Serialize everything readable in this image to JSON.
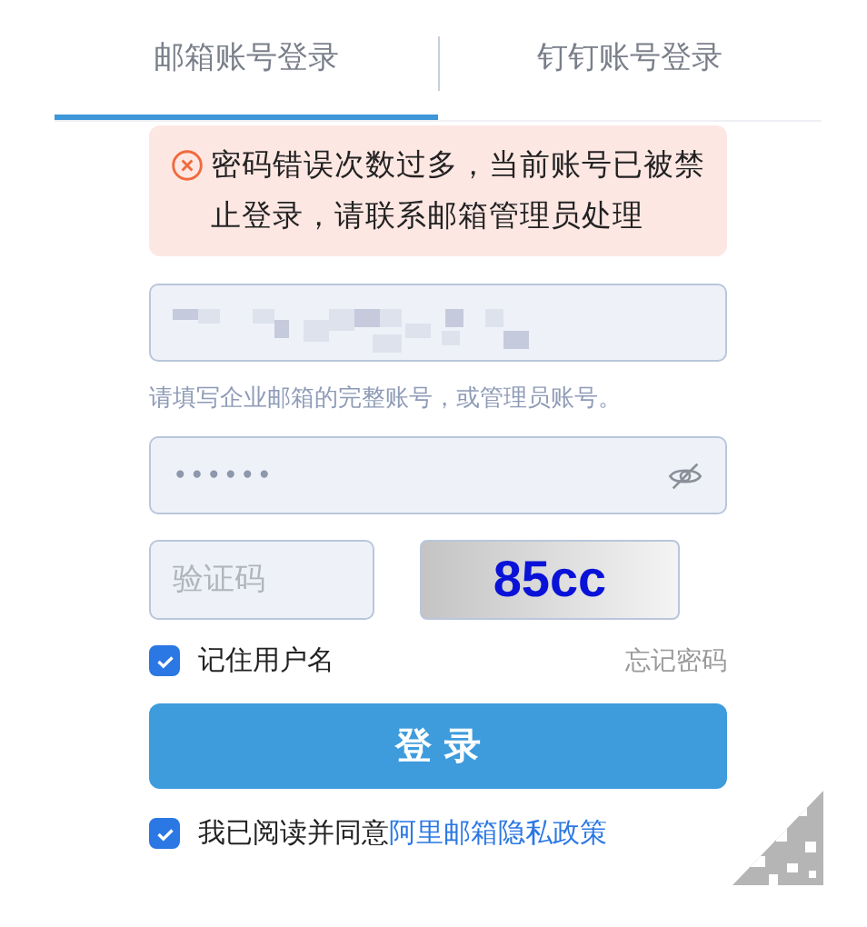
{
  "tabs": [
    {
      "label": "邮箱账号登录",
      "selected": true
    },
    {
      "label": "钉钉账号登录",
      "selected": false
    }
  ],
  "error": {
    "message": "密码错误次数过多，当前账号已被禁止登录，请联系邮箱管理员处理"
  },
  "email": {
    "value_obscured": true,
    "hint": "请填写企业邮箱的完整账号，或管理员账号。"
  },
  "password": {
    "value": "••••••"
  },
  "captcha": {
    "placeholder": "验证码",
    "image_text": "85cc"
  },
  "remember": {
    "label": "记住用户名",
    "checked": true
  },
  "forgot_link": "忘记密码",
  "login_button": "登 录",
  "agreement": {
    "checked": true,
    "text": "我已阅读并同意",
    "link": "阿里邮箱隐私政策"
  }
}
